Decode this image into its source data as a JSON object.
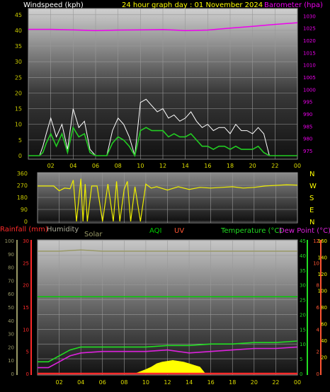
{
  "header": {
    "windspeed_label": "Windspeed (kph)",
    "title": "24 hour graph day : 01 November 2024",
    "barometer_label": "Barometer (hpa)"
  },
  "lower_header": {
    "rainfall": "Rainfall (mm)",
    "humidity": "Humidity",
    "solar": "Solar",
    "aqi": "AQI",
    "uv": "UV",
    "temperature": "Temperature (°C)",
    "dewpoint": "Dew Point (°C)"
  },
  "colors": {
    "wind": "#ffffff",
    "wind_avg": "#22cc22",
    "barometer": "#ee00ee",
    "direction": "#eeee00",
    "rainfall": "#ff2a2a",
    "humidity": "#999966",
    "solar": "#ffff00",
    "aqi": "#00cc00",
    "uv": "#ff5533",
    "temperature": "#22dd22",
    "dewpoint": "#dd22dd",
    "grid": "#999999",
    "axis_labels": "#cccc00"
  },
  "chart_data": [
    {
      "type": "line",
      "id": "wind",
      "x_ticks": [
        "02",
        "04",
        "06",
        "08",
        "10",
        "12",
        "14",
        "16",
        "18",
        "20",
        "22",
        "00"
      ],
      "x_range_hours": [
        0,
        24
      ],
      "y_left": {
        "label": "Windspeed (kph)",
        "ticks": [
          0,
          5,
          10,
          15,
          20,
          25,
          30,
          35,
          40,
          45
        ],
        "range": [
          0,
          47
        ]
      },
      "y_right": {
        "label": "Barometer (hpa)",
        "ticks": [
          975,
          980,
          985,
          990,
          995,
          1000,
          1005,
          1010,
          1015,
          1020,
          1025,
          1030
        ],
        "range": [
          973,
          1033
        ]
      },
      "series": [
        {
          "key": "gust",
          "hours": [
            0,
            1,
            1.3,
            1.6,
            2,
            2.5,
            3,
            3.5,
            4,
            4.5,
            5,
            5.5,
            6,
            6.5,
            7,
            7.5,
            8,
            8.5,
            9,
            9.5,
            10,
            10.5,
            11,
            11.5,
            12,
            12.5,
            13,
            13.5,
            14,
            14.5,
            15,
            15.5,
            16,
            16.5,
            17,
            17.5,
            18,
            18.5,
            19,
            19.5,
            20,
            20.5,
            21,
            21.5,
            22,
            23,
            24
          ],
          "values": [
            0,
            0,
            3,
            7,
            12,
            6,
            10,
            2,
            15,
            9,
            11,
            2,
            0,
            0,
            0,
            8,
            12,
            10,
            6,
            0,
            17,
            18,
            16,
            14,
            15,
            12,
            13,
            11,
            12,
            14,
            11,
            9,
            10,
            8,
            9,
            9,
            7,
            10,
            8,
            8,
            7,
            9,
            7,
            0,
            0,
            0,
            0
          ]
        },
        {
          "key": "average",
          "hours": [
            0,
            1,
            1.3,
            1.6,
            2,
            2.5,
            3,
            3.5,
            4,
            4.5,
            5,
            5.5,
            6,
            6.5,
            7,
            7.5,
            8,
            8.5,
            9,
            9.5,
            10,
            10.5,
            11,
            11.5,
            12,
            12.5,
            13,
            13.5,
            14,
            14.5,
            15,
            15.5,
            16,
            16.5,
            17,
            17.5,
            18,
            18.5,
            19,
            19.5,
            20,
            20.5,
            21,
            21.5,
            22,
            23,
            24
          ],
          "values": [
            0,
            0,
            1,
            4,
            7,
            3,
            7,
            1,
            9,
            6,
            7,
            1,
            0,
            0,
            0,
            4,
            6,
            5,
            3,
            0,
            8,
            9,
            8,
            8,
            8,
            6,
            7,
            6,
            6,
            7,
            5,
            3,
            3,
            2,
            3,
            3,
            2,
            3,
            2,
            2,
            2,
            3,
            1,
            0,
            0,
            0,
            0
          ]
        },
        {
          "key": "barometer",
          "hours": [
            0,
            2,
            4,
            6,
            8,
            10,
            12,
            14,
            16,
            18,
            20,
            22,
            24
          ],
          "values": [
            1024.5,
            1024.5,
            1024.3,
            1024.0,
            1024.2,
            1024.3,
            1024.4,
            1024.0,
            1024.2,
            1025.0,
            1025.7,
            1026.5,
            1027.2
          ]
        }
      ]
    },
    {
      "type": "line",
      "id": "direction",
      "x_ticks": [
        "02",
        "04",
        "06",
        "08",
        "10",
        "12",
        "14",
        "16",
        "18",
        "20",
        "22",
        "00"
      ],
      "y_left": {
        "ticks": [
          0,
          90,
          180,
          270,
          360
        ],
        "range": [
          0,
          360
        ]
      },
      "y_right": {
        "labels": [
          "N",
          "W",
          "S",
          "E",
          "N"
        ]
      },
      "series": [
        {
          "key": "direction",
          "hours": [
            0,
            1,
            1.5,
            2,
            2.5,
            3,
            3.3,
            3.6,
            4,
            4.2,
            4.4,
            4.6,
            5,
            5.5,
            6,
            6.5,
            7,
            7.3,
            7.6,
            8,
            8.3,
            8.6,
            9,
            9.5,
            10,
            10.5,
            11,
            12,
            13,
            14,
            15,
            16,
            17,
            18,
            19,
            20,
            21,
            22,
            23,
            24
          ],
          "values": [
            265,
            265,
            265,
            230,
            250,
            245,
            310,
            0,
            320,
            0,
            280,
            0,
            265,
            265,
            0,
            280,
            0,
            300,
            0,
            240,
            300,
            0,
            260,
            0,
            280,
            250,
            260,
            235,
            260,
            240,
            255,
            250,
            255,
            260,
            250,
            255,
            265,
            270,
            275,
            272
          ]
        }
      ]
    },
    {
      "type": "line",
      "id": "temperature",
      "x_ticks": [
        "02",
        "04",
        "06",
        "08",
        "10",
        "12",
        "14",
        "16",
        "18",
        "20",
        "22",
        "00"
      ],
      "y_axes": [
        {
          "key": "humidity",
          "ticks": [
            0,
            10,
            20,
            30,
            40,
            50,
            60,
            70,
            80,
            90,
            100
          ]
        },
        {
          "key": "rainfall",
          "ticks": [
            0,
            5,
            10,
            15,
            20,
            25,
            30
          ]
        },
        {
          "key": "temperature",
          "ticks": [
            0,
            5,
            10,
            15,
            20,
            25,
            30,
            35,
            40,
            45
          ]
        },
        {
          "key": "solar",
          "ticks": [
            20,
            40,
            60,
            80,
            100,
            120,
            140,
            160
          ]
        },
        {
          "key": "uv",
          "ticks": [
            0,
            2,
            4,
            6,
            8,
            10,
            12
          ]
        }
      ],
      "series": [
        {
          "key": "humidity",
          "hours": [
            0,
            2,
            4,
            6,
            8,
            10,
            12,
            14,
            16,
            18,
            20,
            22,
            24
          ],
          "values": [
            92,
            92,
            93,
            92,
            92,
            92,
            92,
            92,
            92,
            92,
            92,
            92,
            92
          ]
        },
        {
          "key": "aqi",
          "hours": [
            0,
            24
          ],
          "values": [
            26,
            26
          ]
        },
        {
          "key": "temperature",
          "hours": [
            0,
            1,
            2,
            3,
            4,
            6,
            8,
            10,
            12,
            14,
            16,
            18,
            20,
            22,
            24
          ],
          "values": [
            4,
            4,
            6,
            8,
            9,
            9,
            9,
            9,
            9.5,
            9.5,
            10,
            10,
            10.5,
            10.5,
            11
          ]
        },
        {
          "key": "dewpoint",
          "hours": [
            0,
            1,
            2,
            3,
            4,
            6,
            8,
            10,
            12,
            14,
            16,
            18,
            20,
            22,
            24
          ],
          "values": [
            2,
            2,
            4,
            6,
            7,
            7.5,
            7.5,
            7.5,
            8,
            7,
            7.5,
            8,
            8.5,
            8.5,
            9
          ]
        },
        {
          "key": "solar",
          "hours": [
            9,
            10,
            10.5,
            11,
            11.5,
            12,
            12.5,
            13,
            13.5,
            14,
            14.5,
            15,
            15.5
          ],
          "values": [
            0,
            5,
            8,
            12,
            14,
            15,
            16,
            15,
            14,
            12,
            10,
            8,
            0
          ]
        },
        {
          "key": "rainfall",
          "hours": [
            0,
            24
          ],
          "values": [
            0,
            0
          ]
        }
      ]
    }
  ]
}
